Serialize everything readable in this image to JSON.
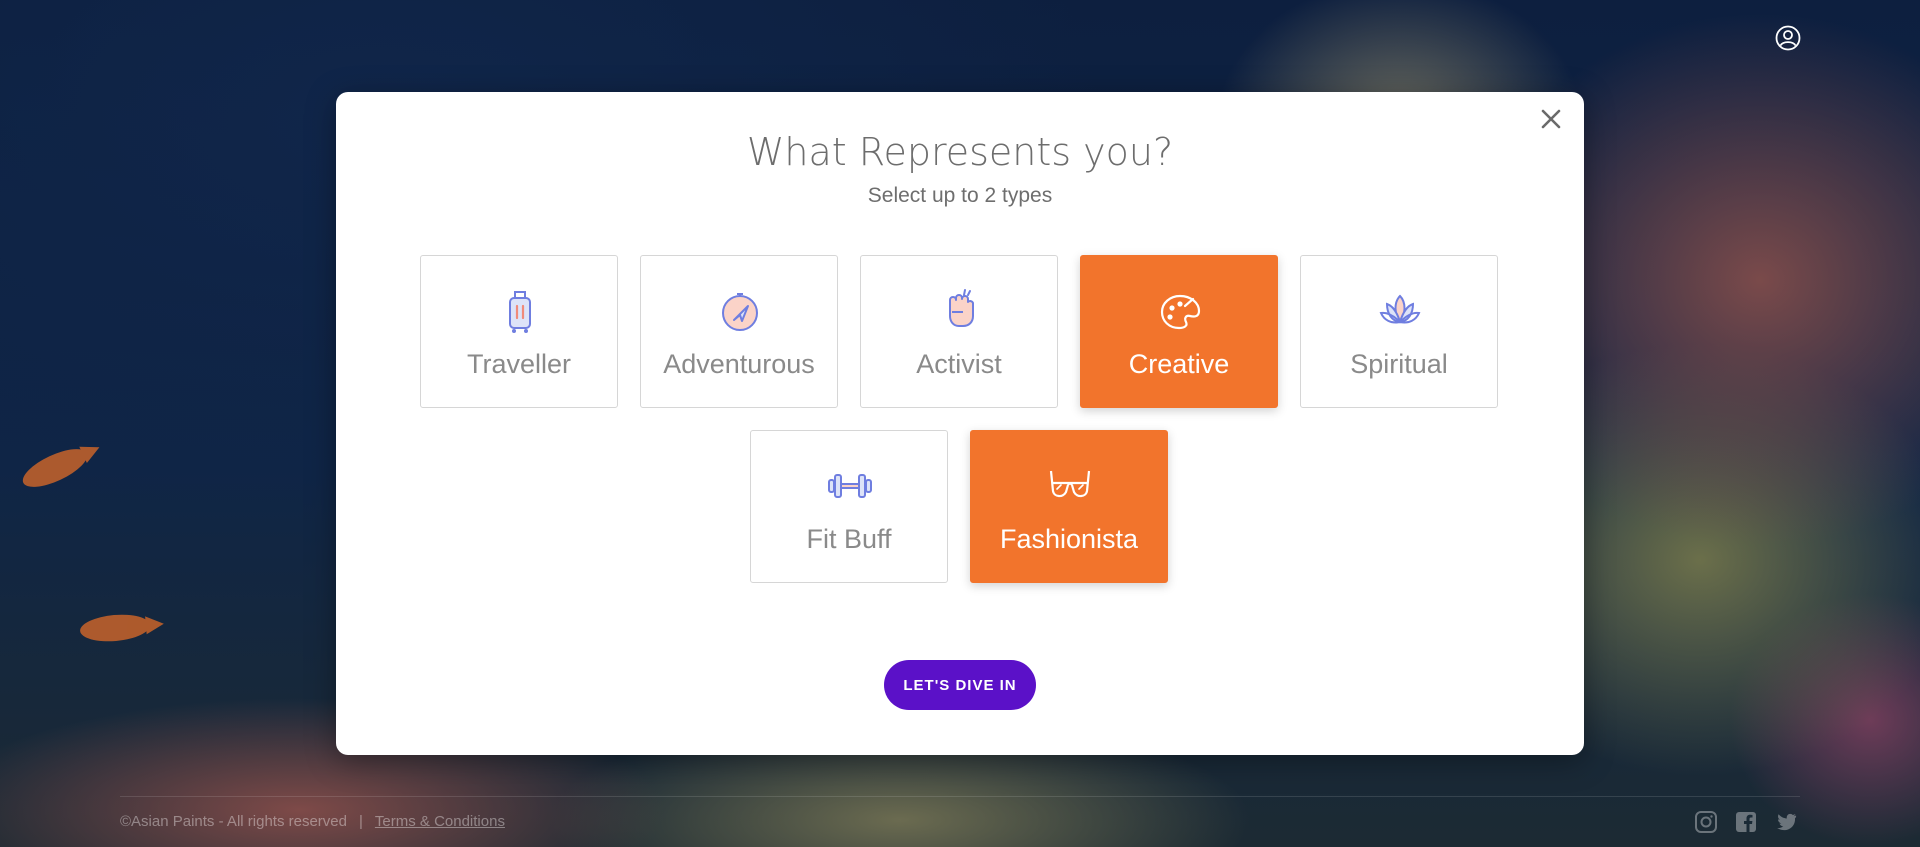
{
  "modal": {
    "title": "What Represents you?",
    "subtitle": "Select up to 2 types",
    "cta_label": "LET'S DIVE IN",
    "accent_color": "#f2742c",
    "cta_color": "#5b11c8",
    "options": [
      {
        "label": "Traveller",
        "icon": "suitcase-icon",
        "selected": false
      },
      {
        "label": "Adventurous",
        "icon": "compass-icon",
        "selected": false
      },
      {
        "label": "Activist",
        "icon": "raised-fist-icon",
        "selected": false
      },
      {
        "label": "Creative",
        "icon": "palette-icon",
        "selected": true
      },
      {
        "label": "Spiritual",
        "icon": "lotus-icon",
        "selected": false
      },
      {
        "label": "Fit Buff",
        "icon": "dumbbell-icon",
        "selected": false
      },
      {
        "label": "Fashionista",
        "icon": "sunglasses-icon",
        "selected": true
      }
    ]
  },
  "header": {
    "account_icon": "user-account-icon"
  },
  "footer": {
    "copyright": "©Asian Paints - All rights reserved",
    "separator": "|",
    "terms_link": "Terms & Conditions",
    "social_icons": [
      "instagram-icon",
      "facebook-icon",
      "twitter-icon"
    ]
  }
}
